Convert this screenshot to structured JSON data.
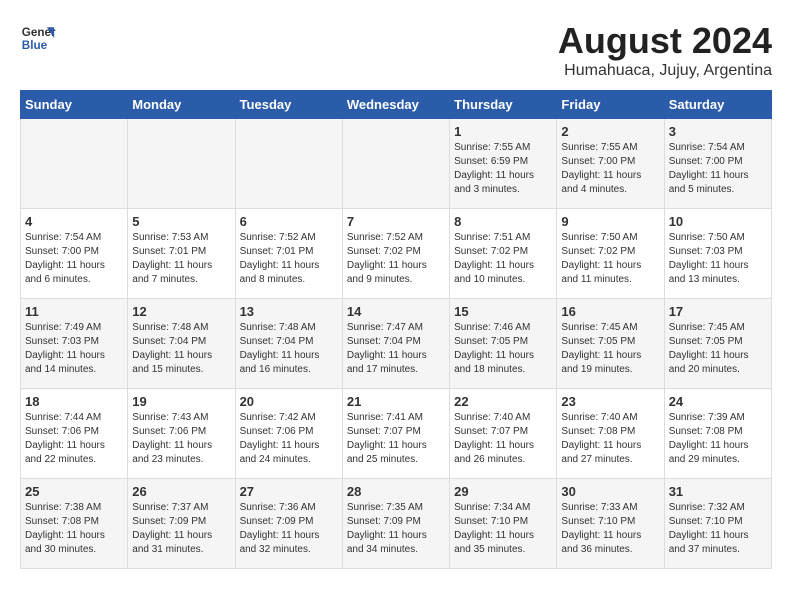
{
  "header": {
    "title": "August 2024",
    "subtitle": "Humahuaca, Jujuy, Argentina",
    "logo_general": "General",
    "logo_blue": "Blue"
  },
  "days_of_week": [
    "Sunday",
    "Monday",
    "Tuesday",
    "Wednesday",
    "Thursday",
    "Friday",
    "Saturday"
  ],
  "weeks": [
    [
      {
        "day": "",
        "info": ""
      },
      {
        "day": "",
        "info": ""
      },
      {
        "day": "",
        "info": ""
      },
      {
        "day": "",
        "info": ""
      },
      {
        "day": "1",
        "info": "Sunrise: 7:55 AM\nSunset: 6:59 PM\nDaylight: 11 hours and 3 minutes."
      },
      {
        "day": "2",
        "info": "Sunrise: 7:55 AM\nSunset: 7:00 PM\nDaylight: 11 hours and 4 minutes."
      },
      {
        "day": "3",
        "info": "Sunrise: 7:54 AM\nSunset: 7:00 PM\nDaylight: 11 hours and 5 minutes."
      }
    ],
    [
      {
        "day": "4",
        "info": "Sunrise: 7:54 AM\nSunset: 7:00 PM\nDaylight: 11 hours and 6 minutes."
      },
      {
        "day": "5",
        "info": "Sunrise: 7:53 AM\nSunset: 7:01 PM\nDaylight: 11 hours and 7 minutes."
      },
      {
        "day": "6",
        "info": "Sunrise: 7:52 AM\nSunset: 7:01 PM\nDaylight: 11 hours and 8 minutes."
      },
      {
        "day": "7",
        "info": "Sunrise: 7:52 AM\nSunset: 7:02 PM\nDaylight: 11 hours and 9 minutes."
      },
      {
        "day": "8",
        "info": "Sunrise: 7:51 AM\nSunset: 7:02 PM\nDaylight: 11 hours and 10 minutes."
      },
      {
        "day": "9",
        "info": "Sunrise: 7:50 AM\nSunset: 7:02 PM\nDaylight: 11 hours and 11 minutes."
      },
      {
        "day": "10",
        "info": "Sunrise: 7:50 AM\nSunset: 7:03 PM\nDaylight: 11 hours and 13 minutes."
      }
    ],
    [
      {
        "day": "11",
        "info": "Sunrise: 7:49 AM\nSunset: 7:03 PM\nDaylight: 11 hours and 14 minutes."
      },
      {
        "day": "12",
        "info": "Sunrise: 7:48 AM\nSunset: 7:04 PM\nDaylight: 11 hours and 15 minutes."
      },
      {
        "day": "13",
        "info": "Sunrise: 7:48 AM\nSunset: 7:04 PM\nDaylight: 11 hours and 16 minutes."
      },
      {
        "day": "14",
        "info": "Sunrise: 7:47 AM\nSunset: 7:04 PM\nDaylight: 11 hours and 17 minutes."
      },
      {
        "day": "15",
        "info": "Sunrise: 7:46 AM\nSunset: 7:05 PM\nDaylight: 11 hours and 18 minutes."
      },
      {
        "day": "16",
        "info": "Sunrise: 7:45 AM\nSunset: 7:05 PM\nDaylight: 11 hours and 19 minutes."
      },
      {
        "day": "17",
        "info": "Sunrise: 7:45 AM\nSunset: 7:05 PM\nDaylight: 11 hours and 20 minutes."
      }
    ],
    [
      {
        "day": "18",
        "info": "Sunrise: 7:44 AM\nSunset: 7:06 PM\nDaylight: 11 hours and 22 minutes."
      },
      {
        "day": "19",
        "info": "Sunrise: 7:43 AM\nSunset: 7:06 PM\nDaylight: 11 hours and 23 minutes."
      },
      {
        "day": "20",
        "info": "Sunrise: 7:42 AM\nSunset: 7:06 PM\nDaylight: 11 hours and 24 minutes."
      },
      {
        "day": "21",
        "info": "Sunrise: 7:41 AM\nSunset: 7:07 PM\nDaylight: 11 hours and 25 minutes."
      },
      {
        "day": "22",
        "info": "Sunrise: 7:40 AM\nSunset: 7:07 PM\nDaylight: 11 hours and 26 minutes."
      },
      {
        "day": "23",
        "info": "Sunrise: 7:40 AM\nSunset: 7:08 PM\nDaylight: 11 hours and 27 minutes."
      },
      {
        "day": "24",
        "info": "Sunrise: 7:39 AM\nSunset: 7:08 PM\nDaylight: 11 hours and 29 minutes."
      }
    ],
    [
      {
        "day": "25",
        "info": "Sunrise: 7:38 AM\nSunset: 7:08 PM\nDaylight: 11 hours and 30 minutes."
      },
      {
        "day": "26",
        "info": "Sunrise: 7:37 AM\nSunset: 7:09 PM\nDaylight: 11 hours and 31 minutes."
      },
      {
        "day": "27",
        "info": "Sunrise: 7:36 AM\nSunset: 7:09 PM\nDaylight: 11 hours and 32 minutes."
      },
      {
        "day": "28",
        "info": "Sunrise: 7:35 AM\nSunset: 7:09 PM\nDaylight: 11 hours and 34 minutes."
      },
      {
        "day": "29",
        "info": "Sunrise: 7:34 AM\nSunset: 7:10 PM\nDaylight: 11 hours and 35 minutes."
      },
      {
        "day": "30",
        "info": "Sunrise: 7:33 AM\nSunset: 7:10 PM\nDaylight: 11 hours and 36 minutes."
      },
      {
        "day": "31",
        "info": "Sunrise: 7:32 AM\nSunset: 7:10 PM\nDaylight: 11 hours and 37 minutes."
      }
    ]
  ]
}
